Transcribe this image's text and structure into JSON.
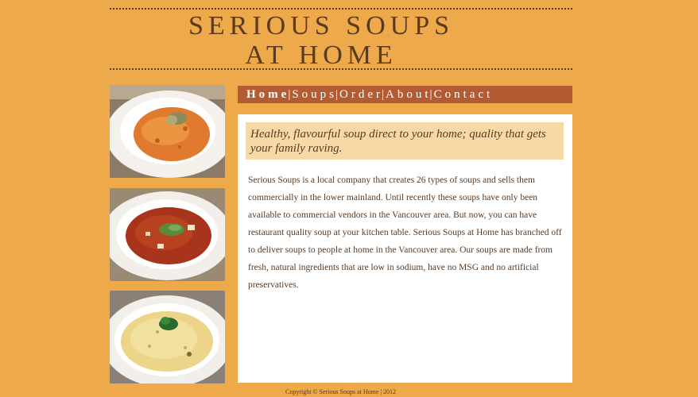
{
  "header": {
    "title_line1": "SERIOUS SOUPS",
    "title_line2": "AT HOME"
  },
  "nav": {
    "items": [
      "Home",
      "Soups",
      "Order",
      "About",
      "Contact"
    ],
    "separator": "|",
    "active": "Home"
  },
  "images": [
    {
      "name": "soup-photo-tomato-bisque",
      "soup_color": "#e07a2e"
    },
    {
      "name": "soup-photo-red-broth",
      "soup_color": "#a8341c"
    },
    {
      "name": "soup-photo-cream-rice",
      "soup_color": "#ecd488"
    }
  ],
  "main": {
    "tagline": "Healthy, flavourful soup direct to your home; quality that gets your family raving.",
    "intro": "Serious Soups is a local company that creates 26 types of soups and sells them commercially in the lower mainland. Until recently these soups have only been available to commercial vendors in the Vancouver area. But now, you can have restaurant quality soup at your kitchen table. Serious Soups at Home has branched off to deliver soups to people at home in the Vancouver area. Our soups are made from fresh, natural ingredients that are low in sodium, have no MSG and no artificial preservatives."
  },
  "footer": {
    "copyright": "Copyright © Serious Soups at Home | 2012"
  },
  "colors": {
    "background": "#eda94a",
    "nav_bg": "#b35c34",
    "tagline_bg": "#f7d9a8",
    "text": "#5b3a20"
  }
}
